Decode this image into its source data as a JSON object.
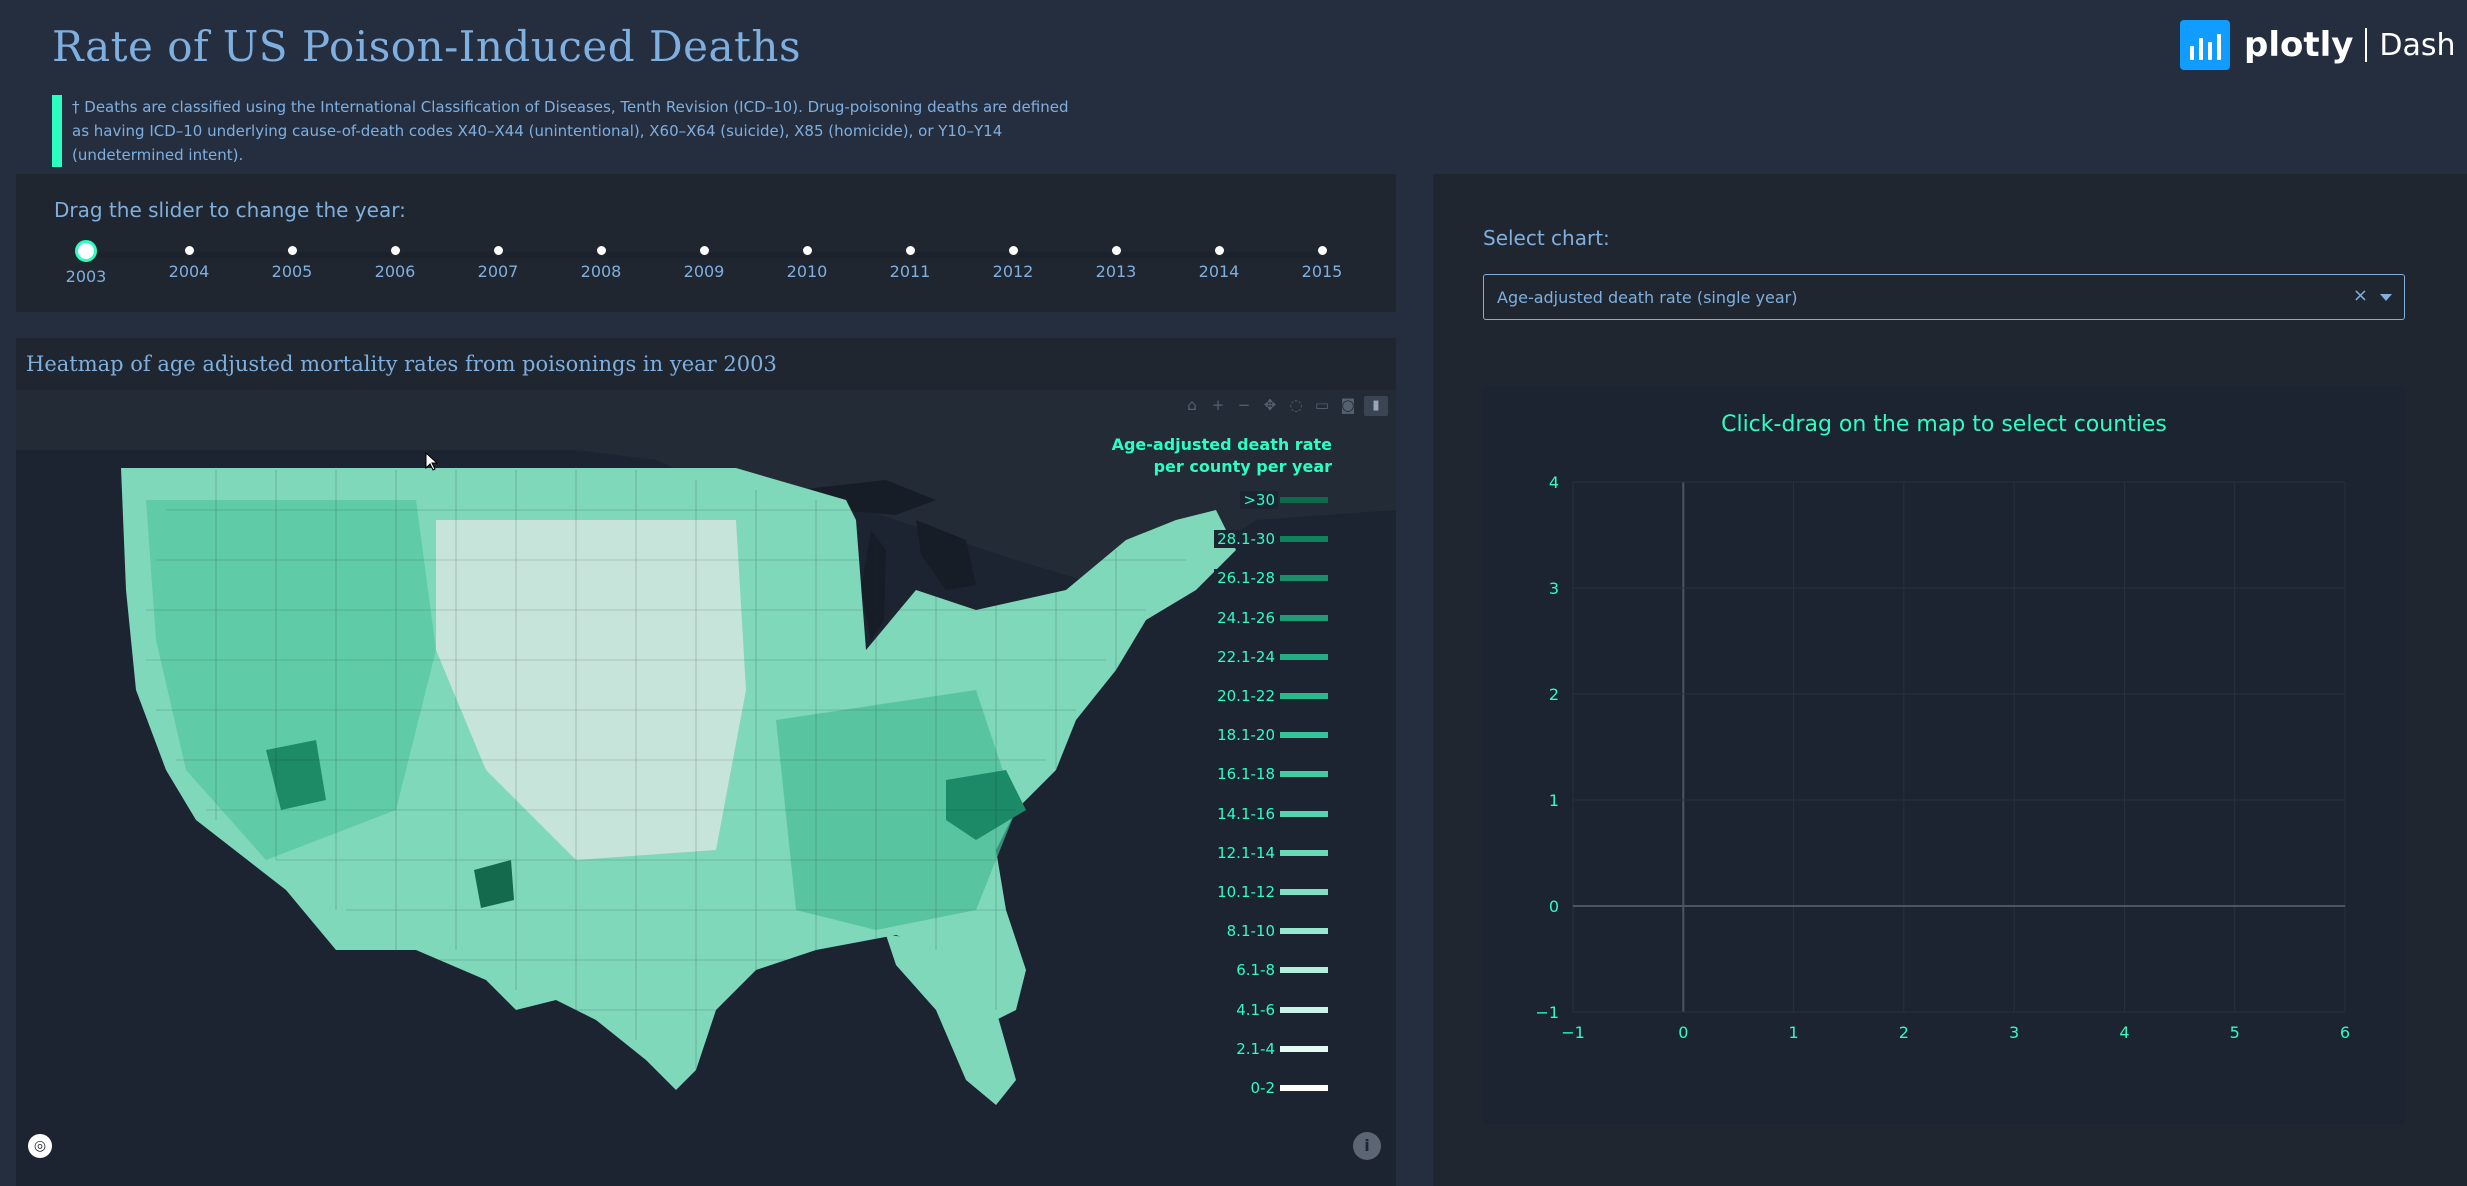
{
  "header": {
    "title": "Rate of US Poison-Induced Deaths",
    "description": "† Deaths are classified using the International Classification of Diseases, Tenth Revision (ICD–10). Drug-poisoning deaths are defined as having ICD–10 underlying cause-of-death codes X40–X44 (unintentional), X60–X64 (suicide), X85 (homicide), or Y10–Y14 (undetermined intent)."
  },
  "logo": {
    "brand": "plotly",
    "product": "Dash",
    "icon": "plotly-logo-icon"
  },
  "slider": {
    "label": "Drag the slider to change the year:",
    "years": [
      "2003",
      "2004",
      "2005",
      "2006",
      "2007",
      "2008",
      "2009",
      "2010",
      "2011",
      "2012",
      "2013",
      "2014",
      "2015"
    ],
    "selected": "2003"
  },
  "map": {
    "title": "Heatmap of age adjusted mortality rates from poisonings in year 2003",
    "legend_title_1": "Age-adjusted death rate",
    "legend_title_2": "per county per year",
    "legend": [
      {
        "label": ">30",
        "color": "#0c6b4c"
      },
      {
        "label": "28.1-30",
        "color": "#11815c"
      },
      {
        "label": "26.1-28",
        "color": "#16906a"
      },
      {
        "label": "24.1-26",
        "color": "#1b9e76"
      },
      {
        "label": "22.1-24",
        "color": "#22ad84"
      },
      {
        "label": "20.1-22",
        "color": "#2ab88f"
      },
      {
        "label": "18.1-20",
        "color": "#36c39a"
      },
      {
        "label": "16.1-18",
        "color": "#45cba4"
      },
      {
        "label": "14.1-16",
        "color": "#56d3ae"
      },
      {
        "label": "12.1-14",
        "color": "#6ad9b7"
      },
      {
        "label": "10.1-12",
        "color": "#80e0c2"
      },
      {
        "label": "8.1-10",
        "color": "#98e7cf"
      },
      {
        "label": "6.1-8",
        "color": "#b2eedb"
      },
      {
        "label": "4.1-6",
        "color": "#ccf4e8"
      },
      {
        "label": "2.1-4",
        "color": "#e5faf3"
      },
      {
        "label": "0-2",
        "color": "#ffffff"
      }
    ],
    "modebar_icons": [
      "home-icon",
      "zoom-in-icon",
      "zoom-out-icon",
      "pan-icon",
      "lasso-icon",
      "box-select-icon",
      "camera-icon",
      "plotly-icon"
    ]
  },
  "chart_select": {
    "label": "Select chart:",
    "value": "Age-adjusted death rate (single year)"
  },
  "chart_data": {
    "type": "scatter",
    "title": "Click-drag on the map to select counties",
    "xlim": [
      -1,
      6
    ],
    "ylim": [
      -1,
      4
    ],
    "x_ticks": [
      "−1",
      "0",
      "1",
      "2",
      "3",
      "4",
      "5",
      "6"
    ],
    "y_ticks": [
      "−1",
      "0",
      "1",
      "2",
      "3",
      "4"
    ],
    "grid": true,
    "series": []
  },
  "colors": {
    "background": "#252e3f",
    "panel": "#1f2630",
    "text": "#7fafdf",
    "accent": "#2cfec1"
  }
}
